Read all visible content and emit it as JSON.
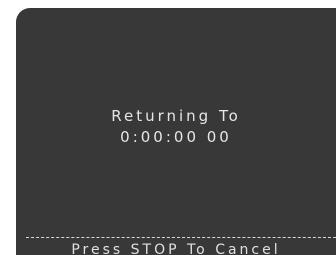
{
  "screen": {
    "status_line": "Returning To",
    "timecode": "0:00:00 00",
    "footer_hint": "Press STOP To Cancel"
  },
  "colors": {
    "panel_background": "#383838",
    "text": "#e6e6e6"
  }
}
